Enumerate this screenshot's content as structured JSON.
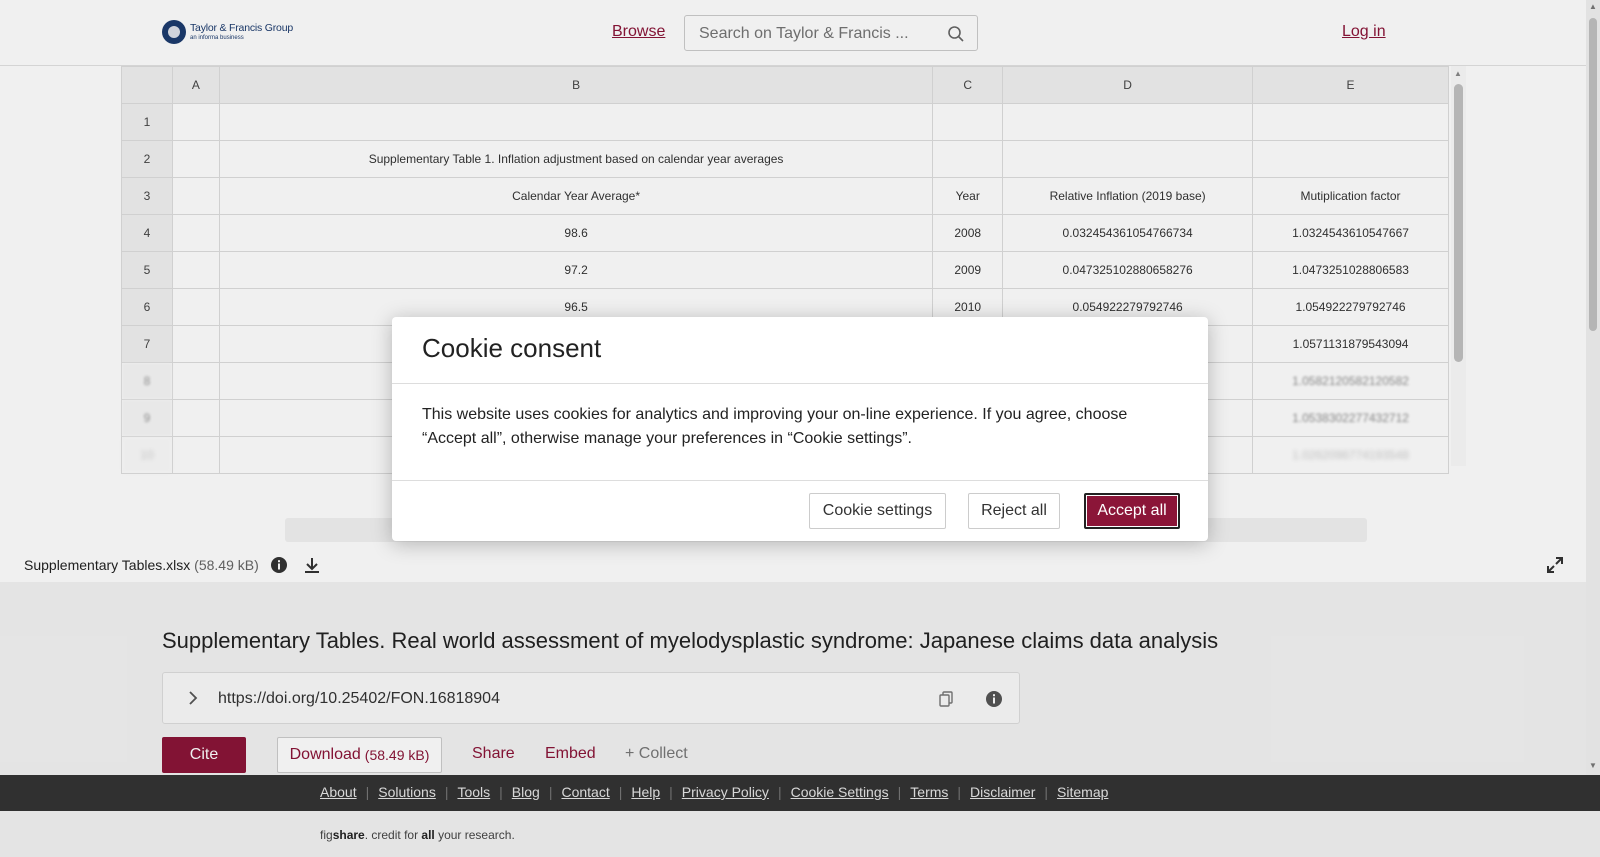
{
  "header": {
    "logo_title": "Taylor & Francis Group",
    "logo_sub": "an informa business",
    "browse": "Browse",
    "search_placeholder": "Search on Taylor & Francis ...",
    "login": "Log in"
  },
  "sheet": {
    "columns": [
      "A",
      "B",
      "C",
      "D",
      "E"
    ],
    "rows": [
      {
        "n": "1",
        "A": "",
        "B": "",
        "C": "",
        "D": "",
        "E": ""
      },
      {
        "n": "2",
        "A": "",
        "B": "Supplementary Table 1. Inflation adjustment based on calendar year averages",
        "C": "",
        "D": "",
        "E": ""
      },
      {
        "n": "3",
        "A": "",
        "B": "Calendar Year Average*",
        "C": "Year",
        "D": "Relative Inflation (2019 base)",
        "E": "Mutiplication factor"
      },
      {
        "n": "4",
        "A": "",
        "B": "98.6",
        "C": "2008",
        "D": "0.032454361054766734",
        "E": "1.0324543610547667"
      },
      {
        "n": "5",
        "A": "",
        "B": "97.2",
        "C": "2009",
        "D": "0.047325102880658276",
        "E": "1.0473251028806583"
      },
      {
        "n": "6",
        "A": "",
        "B": "96.5",
        "C": "2010",
        "D": "0.054922279792746",
        "E": "1.054922279792746"
      },
      {
        "n": "7",
        "A": "",
        "B": "",
        "C": "",
        "D": "",
        "E": "1.0571131879543094"
      },
      {
        "n": "8",
        "A": "",
        "B": "",
        "C": "",
        "D": "",
        "E": "1.0582120582120582"
      },
      {
        "n": "9",
        "A": "",
        "B": "",
        "C": "",
        "D": "",
        "E": "1.0538302277432712"
      },
      {
        "n": "10",
        "A": "",
        "B": "",
        "C": "",
        "D": "",
        "E": "1.0262096774193548"
      }
    ]
  },
  "file_bar": {
    "name": "Supplementary Tables.xlsx",
    "size": "(58.49 kB)"
  },
  "article": {
    "title": "Supplementary Tables. Real world assessment of myelodysplastic syndrome: Japanese claims data analysis",
    "doi": "https://doi.org/10.25402/FON.16818904",
    "cite": "Cite",
    "download": "Download",
    "download_size": "(58.49 kB)",
    "share": "Share",
    "embed": "Embed",
    "collect": "+ Collect"
  },
  "footer": {
    "links": [
      "About",
      "Solutions",
      "Tools",
      "Blog",
      "Contact",
      "Help",
      "Privacy Policy",
      "Cookie Settings",
      "Terms",
      "Disclaimer",
      "Sitemap"
    ],
    "tagline_a": "fig",
    "tagline_b": "share",
    "tagline_c": ". credit for ",
    "tagline_d": "all",
    "tagline_e": " your research."
  },
  "cookie_modal": {
    "title": "Cookie consent",
    "body": "This website uses cookies for analytics and improving your on-line experience. If you agree, choose “Accept all”, otherwise manage your preferences in “Cookie settings”.",
    "settings": "Cookie settings",
    "reject": "Reject all",
    "accept": "Accept all"
  },
  "colors": {
    "brand": "#8b1538",
    "footer_bg": "#333333"
  }
}
